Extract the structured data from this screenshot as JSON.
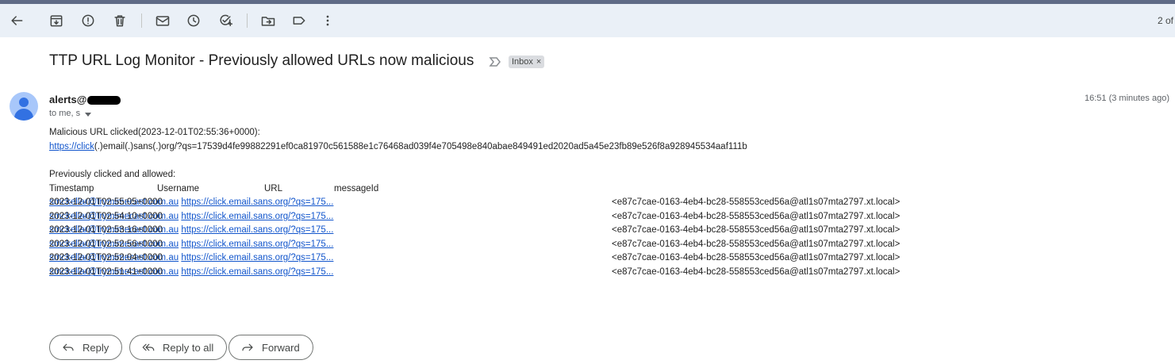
{
  "toolbar": {
    "pager_text": "2 of"
  },
  "email": {
    "subject": "TTP URL Log Monitor - Previously allowed URLs now malicious",
    "label": "Inbox",
    "label_remove": "×",
    "sender_prefix": "alerts@",
    "recipients": "to me, s",
    "time": "16:51 (3 minutes ago)",
    "body": {
      "malicious_heading": "Malicious URL clicked(2023-12-01T02:55:36+0000):",
      "malicious_link_text": "https://click",
      "malicious_rest": "(.)email(.)sans(.)org/?qs=17539d4fe99882291ef0ca81970c561588e1c76468ad039f4e705498e840abae849491ed2020ad5a45e23fb89e526f8a928945534aaf111b",
      "previous_heading": "Previously clicked and allowed:",
      "columns": [
        "Timestamp",
        "Username",
        "URL",
        "messageId"
      ],
      "rows": [
        {
          "timestamp": "2023-12-01T02:55:05+0000",
          "username": "smckellar@trymimecast.com.au",
          "url": "https://click.email.sans.org/?qs=175...",
          "message_id": "<e87c7cae-0163-4eb4-bc28-558553ced56a@atl1s07mta2797.xt.local>"
        },
        {
          "timestamp": "2023-12-01T02:54:10+0000",
          "username": "smckellar@trymimecast.com.au",
          "url": "https://click.email.sans.org/?qs=175...",
          "message_id": "<e87c7cae-0163-4eb4-bc28-558553ced56a@atl1s07mta2797.xt.local>"
        },
        {
          "timestamp": "2023-12-01T02:53:16+0000",
          "username": "smckellar@trymimecast.com.au",
          "url": "https://click.email.sans.org/?qs=175...",
          "message_id": "<e87c7cae-0163-4eb4-bc28-558553ced56a@atl1s07mta2797.xt.local>"
        },
        {
          "timestamp": "2023-12-01T02:52:56+0000",
          "username": "smckellar@trymimecast.com.au",
          "url": "https://click.email.sans.org/?qs=175...",
          "message_id": "<e87c7cae-0163-4eb4-bc28-558553ced56a@atl1s07mta2797.xt.local>"
        },
        {
          "timestamp": "2023-12-01T02:52:04+0000",
          "username": "smckellar@trymimecast.com.au",
          "url": "https://click.email.sans.org/?qs=175...",
          "message_id": "<e87c7cae-0163-4eb4-bc28-558553ced56a@atl1s07mta2797.xt.local>"
        },
        {
          "timestamp": "2023-12-01T02:51:41+0000",
          "username": "smckellar@trymimecast.com.au",
          "url": "https://click.email.sans.org/?qs=175...",
          "message_id": "<e87c7cae-0163-4eb4-bc28-558553ced56a@atl1s07mta2797.xt.local>"
        }
      ]
    }
  },
  "actions": {
    "reply": "Reply",
    "reply_all": "Reply to all",
    "forward": "Forward"
  }
}
